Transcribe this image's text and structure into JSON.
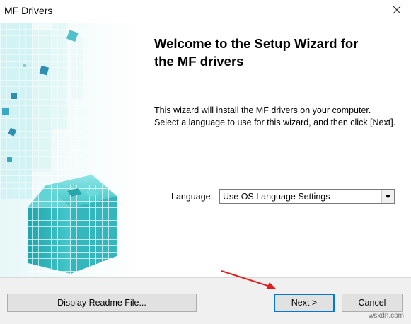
{
  "window": {
    "title": "MF Drivers",
    "close_icon": "close-icon"
  },
  "heading": {
    "line1": "Welcome to the Setup Wizard for",
    "line2": "the MF drivers"
  },
  "description": {
    "line1": "This wizard will install the MF drivers on your computer.",
    "line2": "Select a language to use for this wizard, and then click [Next]."
  },
  "language": {
    "label": "Language:",
    "selected": "Use OS Language Settings"
  },
  "buttons": {
    "readme": "Display Readme File...",
    "next": "Next >",
    "cancel": "Cancel"
  },
  "watermark": "wsxdn.com",
  "colors": {
    "accent": "#0078d7",
    "cube": "#3fc6c9",
    "annotation_arrow": "#e02020"
  }
}
